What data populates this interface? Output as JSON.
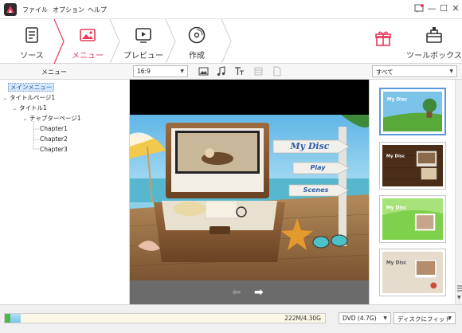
{
  "app": {
    "menu": [
      "ファイル",
      "オプション",
      "ヘルプ"
    ],
    "window_buttons": {
      "minimize": "—",
      "maximize": "☐",
      "close": "✕"
    }
  },
  "steps": [
    {
      "label": "ソース",
      "icon": "document-icon"
    },
    {
      "label": "メニュー",
      "icon": "menu-image-icon",
      "active": true
    },
    {
      "label": "プレビュー",
      "icon": "play-icon"
    },
    {
      "label": "作成",
      "icon": "disc-icon"
    }
  ],
  "tools": [
    {
      "label": "",
      "icon": "gift-box-icon"
    },
    {
      "label": "ツールボックス",
      "icon": "toolbox-icon"
    }
  ],
  "subbar": {
    "menu_panel_title": "メニュー",
    "aspect_ratio": "16:9",
    "template_filter": "すべて"
  },
  "tree": {
    "main_menu": "メインメニュー",
    "title_page": "タイトルページ1",
    "title": "タイトル1",
    "chapter_page": "チャプターページ1",
    "chapters": [
      "Chapter1",
      "Chapter2",
      "Chapter3"
    ]
  },
  "preview": {
    "sign_title": "My Disc",
    "sign_play": "Play",
    "sign_scenes": "Scenes",
    "prev_arrow": "➡",
    "next_arrow": "➡"
  },
  "templates": [
    {
      "title": "My Disc",
      "theme": "island"
    },
    {
      "title": "My Disc",
      "theme": "wood"
    },
    {
      "title": "My Disc",
      "theme": "green"
    },
    {
      "title": "My Disc",
      "theme": "beige"
    }
  ],
  "status": {
    "capacity_text": "222M/4.30G",
    "capacity_fraction": 0.05,
    "disc_type": "DVD (4.7G)",
    "fit_option": "ディスクにフィット"
  },
  "colors": {
    "accent": "#e6395a",
    "selection": "#5a9ad8"
  }
}
